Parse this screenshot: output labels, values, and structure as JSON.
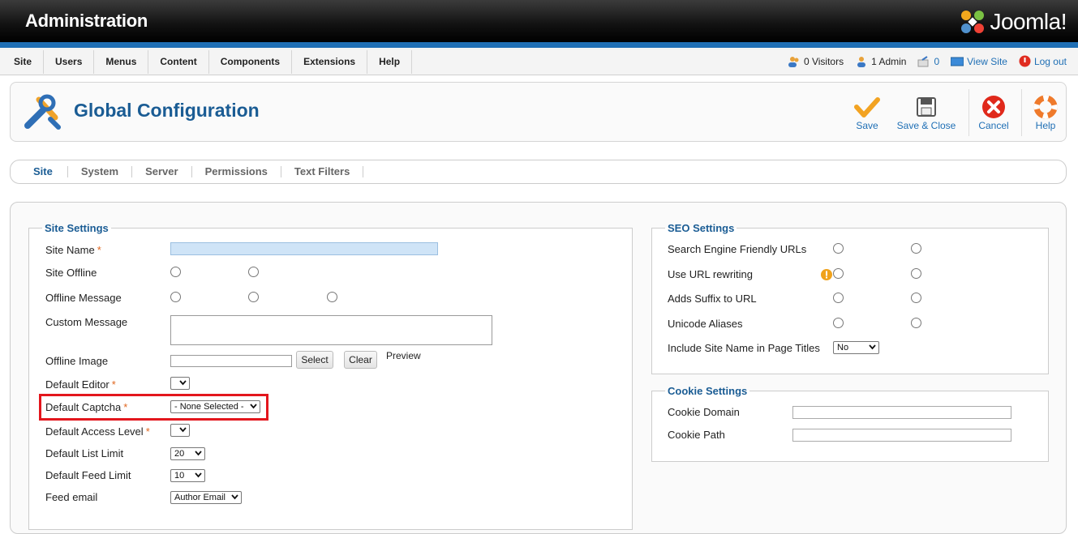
{
  "header": {
    "title": "Administration",
    "logo_text": "Joomla!"
  },
  "menu": [
    "Site",
    "Users",
    "Menus",
    "Content",
    "Components",
    "Extensions",
    "Help"
  ],
  "status": {
    "visitors": "0 Visitors",
    "admins": "1 Admin",
    "messages": "0",
    "view_site": "View Site",
    "logout": "Log out"
  },
  "toolbar": {
    "title": "Global Configuration",
    "save": "Save",
    "save_close": "Save & Close",
    "cancel": "Cancel",
    "help": "Help"
  },
  "tabs": [
    "Site",
    "System",
    "Server",
    "Permissions",
    "Text Filters"
  ],
  "site_settings": {
    "legend": "Site Settings",
    "site_name": "Site Name",
    "site_offline": "Site Offline",
    "offline_message": "Offline Message",
    "custom_message": "Custom Message",
    "offline_image": "Offline Image",
    "select_btn": "Select",
    "clear_btn": "Clear",
    "preview": "Preview",
    "default_editor": "Default Editor",
    "default_captcha": "Default Captcha",
    "captcha_value": "- None Selected -",
    "default_access": "Default Access Level",
    "default_list_limit": "Default List Limit",
    "list_limit_value": "20",
    "default_feed_limit": "Default Feed Limit",
    "feed_limit_value": "10",
    "feed_email": "Feed email",
    "feed_email_value": "Author Email",
    "required_mark": "*"
  },
  "seo_settings": {
    "legend": "SEO Settings",
    "sef_urls": "Search Engine Friendly URLs",
    "url_rewriting": "Use URL rewriting",
    "suffix": "Adds Suffix to URL",
    "unicode": "Unicode Aliases",
    "site_name_titles": "Include Site Name in Page Titles",
    "site_name_titles_value": "No"
  },
  "cookie_settings": {
    "legend": "Cookie Settings",
    "domain": "Cookie Domain",
    "path": "Cookie Path"
  },
  "colors": {
    "accent": "#1f6fb5",
    "title": "#1a5c94",
    "highlight": "#e3161d",
    "required": "#e0661f"
  }
}
